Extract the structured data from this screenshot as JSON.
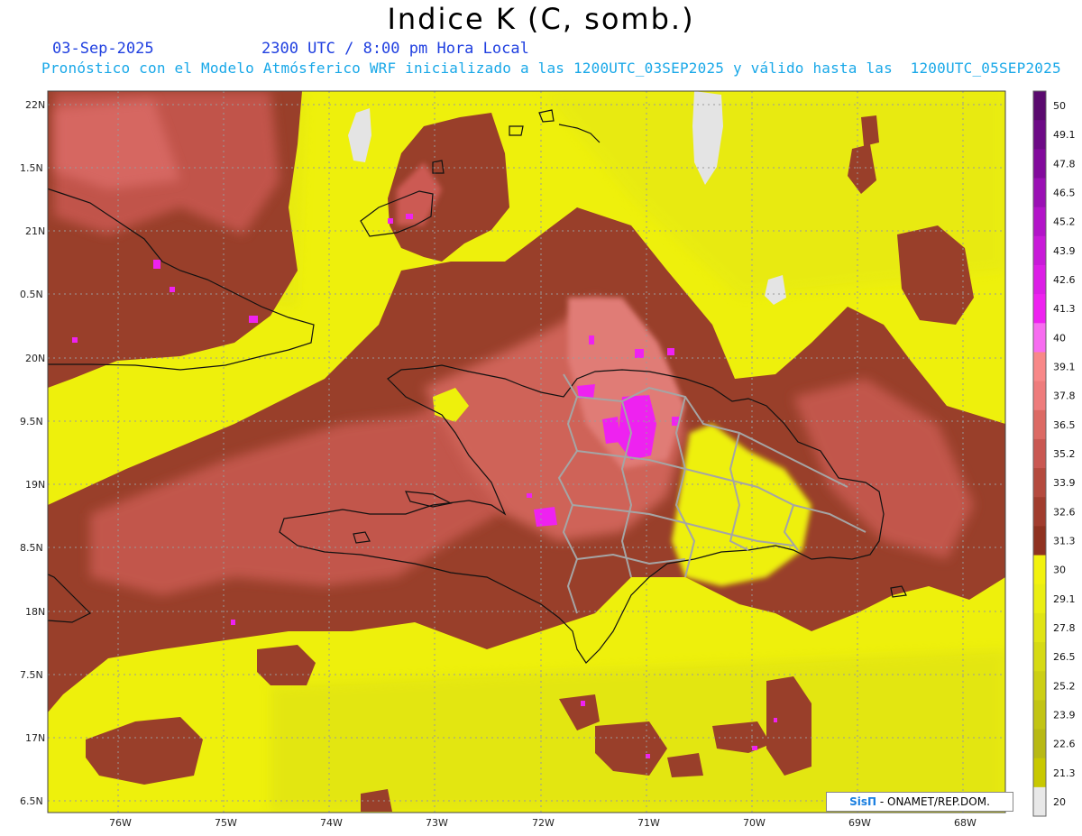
{
  "header": {
    "title": "Indice K (C, somb.)",
    "date": "03-Sep-2025",
    "time": "2300 UTC / 8:00 pm Hora Local",
    "subtitle": "Pronóstico con el Modelo Atmósferico WRF inicializado a las 1200UTC_03SEP2025 y válido hasta las  1200UTC_05SEP2025"
  },
  "map": {
    "lat_labels": [
      "22N",
      "1.5N",
      "21N",
      "0.5N",
      "20N",
      "9.5N",
      "19N",
      "8.5N",
      "18N",
      "7.5N",
      "17N",
      "6.5N"
    ],
    "lon_labels": [
      "76W",
      "75W",
      "74W",
      "73W",
      "72W",
      "71W",
      "70W",
      "69W",
      "68W"
    ],
    "lat_range": [
      16.5,
      22.0
    ],
    "lon_range": [
      -76.6,
      -67.6
    ],
    "grid": true
  },
  "colorbar": {
    "labels": [
      "50",
      "49.1",
      "47.8",
      "46.5",
      "45.2",
      "43.9",
      "42.6",
      "41.3",
      "40",
      "39.1",
      "37.8",
      "36.5",
      "35.2",
      "33.9",
      "32.6",
      "31.3",
      "30",
      "29.1",
      "27.8",
      "26.5",
      "25.2",
      "23.9",
      "22.6",
      "21.3",
      "20"
    ],
    "colors": [
      "#5a0a6e",
      "#6d0a86",
      "#820a9c",
      "#9a10b4",
      "#b214c8",
      "#c81ad8",
      "#dc1ee6",
      "#ee22f0",
      "#f76cf0",
      "#f88888",
      "#ee7c7c",
      "#dc6a64",
      "#c95852",
      "#b44a3e",
      "#a13d2e",
      "#8f3220",
      "#f2f20e",
      "#eaee12",
      "#e0e414",
      "#d6da14",
      "#cccf14",
      "#c2c414",
      "#b8b914",
      "#c8c800",
      "#e8e8e8"
    ]
  },
  "credit": {
    "brand": "SisΠ",
    "text": " - ONAMET/REP.DOM."
  }
}
